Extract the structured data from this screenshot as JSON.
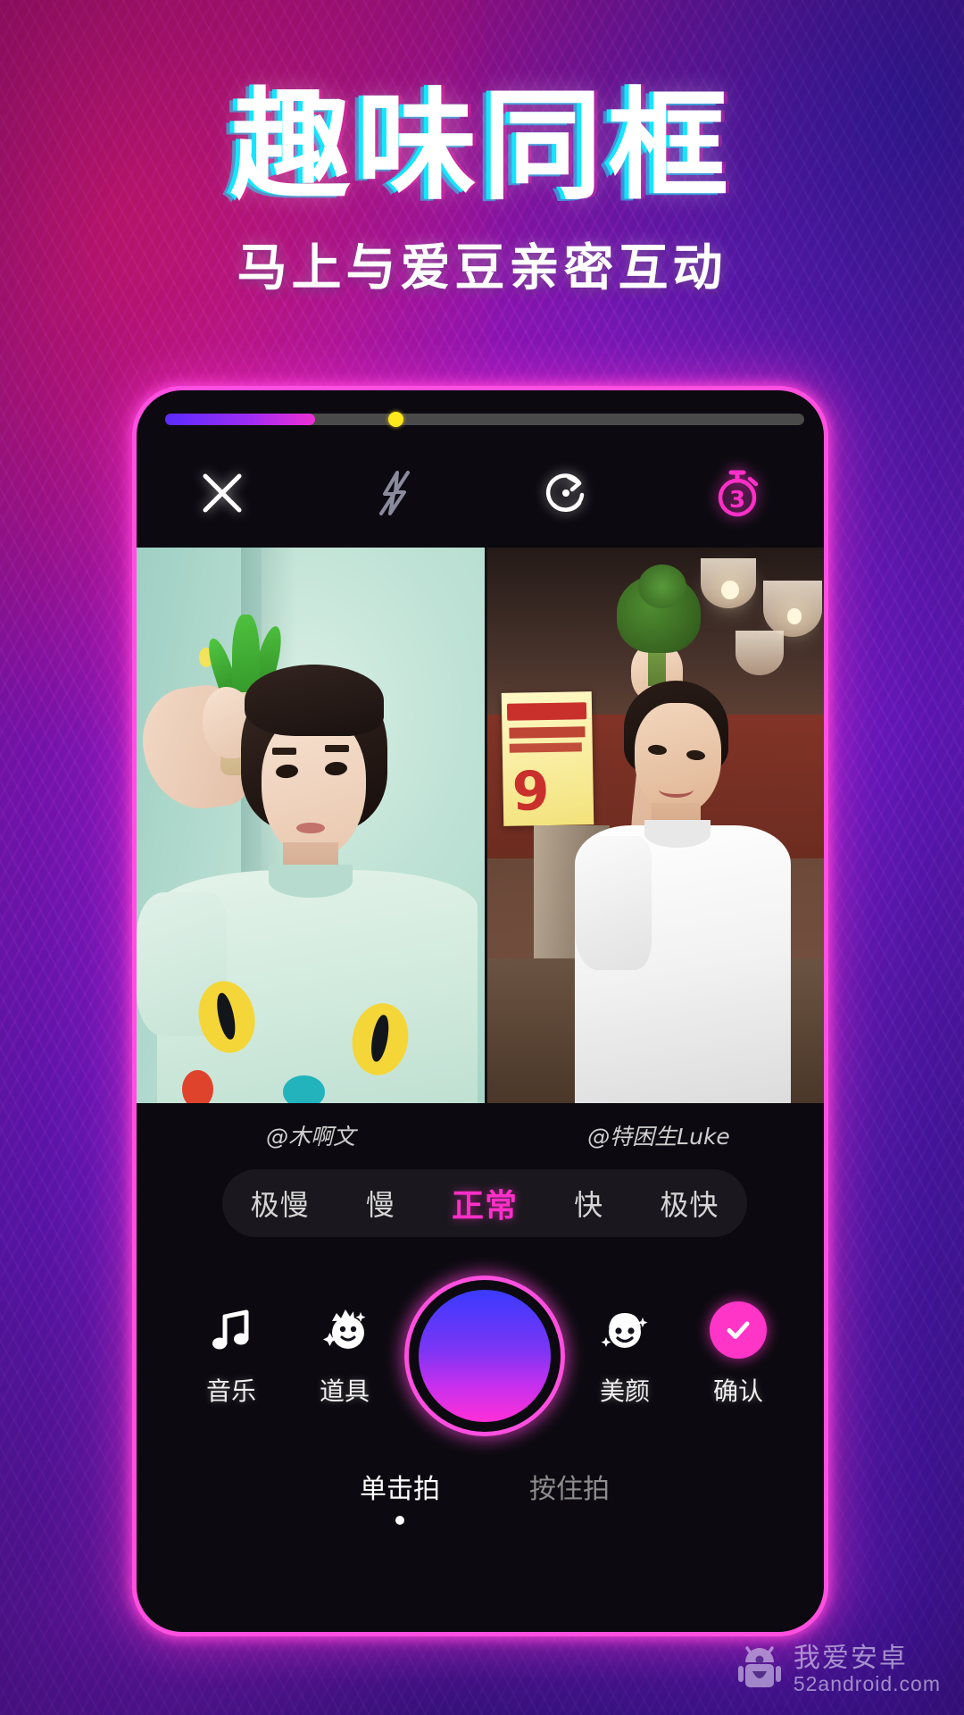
{
  "hero": {
    "title": "趣味同框",
    "subtitle": "马上与爱豆亲密互动",
    "title_glitch_color": "#14e6ff",
    "accent_color": "#ff2fc8"
  },
  "phone": {
    "frame_color": "#ff4fe0",
    "progress": {
      "fill_percent": 23,
      "marker_percent": 35,
      "fill_gradient_from": "#5b2bff",
      "fill_gradient_to": "#ef2fd2",
      "marker_color": "#ffe81c",
      "track_color": "#4a4a4a"
    },
    "toolbar": [
      {
        "name": "close",
        "icon": "close-icon",
        "color": "#ffffff"
      },
      {
        "name": "flash",
        "icon": "flash-off-icon",
        "color": "#8b8b9e"
      },
      {
        "name": "flip-camera",
        "icon": "camera-flip-icon",
        "color": "#ffffff"
      },
      {
        "name": "timer",
        "icon": "timer-icon",
        "color": "#ff2fc8",
        "value": "3"
      }
    ],
    "panes": [
      {
        "username": "@木啊文"
      },
      {
        "username": "@特困生Luke"
      }
    ],
    "speed": {
      "options": [
        "极慢",
        "慢",
        "正常",
        "快",
        "极快"
      ],
      "selected": "正常",
      "selected_color": "#ff2fc8"
    },
    "controls": [
      {
        "label": "音乐",
        "icon": "music-note-icon"
      },
      {
        "label": "道具",
        "icon": "props-sticker-icon"
      },
      {
        "label": "美颜",
        "icon": "beauty-face-icon"
      },
      {
        "label": "确认",
        "icon": "check-icon",
        "badge_color": "#ff35c8"
      }
    ],
    "shutter": {
      "gradient_from": "#3a3bff",
      "gradient_to": "#ff2fd8",
      "ring_color": "#ff4fe0"
    },
    "modes": [
      {
        "label": "单击拍",
        "active": true
      },
      {
        "label": "按住拍",
        "active": false
      }
    ]
  },
  "right_photo_sign": {
    "price": "9"
  },
  "watermark": {
    "cn": "我爱安卓",
    "en": "52android.com",
    "icon": "android-robot-icon"
  }
}
